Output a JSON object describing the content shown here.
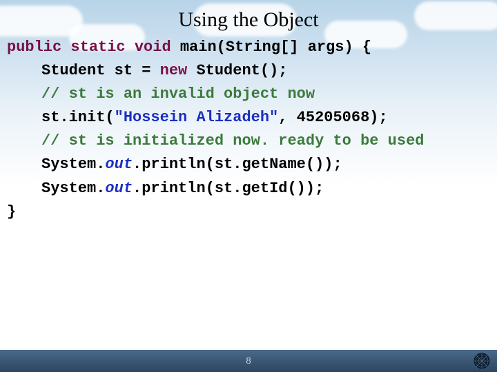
{
  "slide": {
    "title": "Using the Object",
    "page_number": "8"
  },
  "code": {
    "l1_kw1": "public",
    "l1_sp1": " ",
    "l1_kw2": "static",
    "l1_sp2": " ",
    "l1_kw3": "void",
    "l1_rest": " main(String[] args) {",
    "l2_a": "Student st = ",
    "l2_kw": "new",
    "l2_b": " Student();",
    "l3_com": "// st is an invalid object now",
    "l4_a": "st.init(",
    "l4_str": "\"Hossein Alizadeh\"",
    "l4_b": ", 45205068);",
    "l5_com": "// st is initialized now. ready to be used",
    "l6_a": "System.",
    "l6_fld": "out",
    "l6_b": ".println(st.getName());",
    "l7_a": "System.",
    "l7_fld": "out",
    "l7_b": ".println(st.getId());",
    "l8": "}"
  }
}
